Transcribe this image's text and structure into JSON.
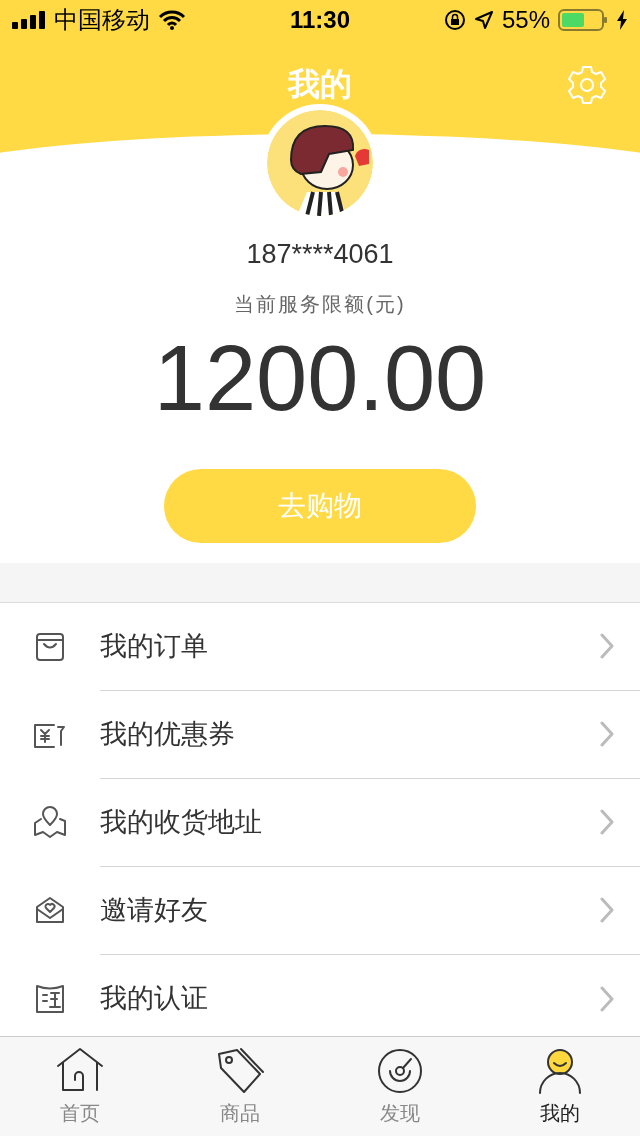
{
  "status_bar": {
    "carrier": "中国移动",
    "time": "11:30",
    "battery": "55%"
  },
  "header": {
    "title": "我的"
  },
  "profile": {
    "phone": "187****4061",
    "limit_label": "当前服务限额(元)",
    "limit_amount": "1200.00",
    "action_button": "去购物"
  },
  "menu": [
    {
      "kind": "orders",
      "label": "我的订单"
    },
    {
      "kind": "coupons",
      "label": "我的优惠券"
    },
    {
      "kind": "address",
      "label": "我的收货地址"
    },
    {
      "kind": "invite",
      "label": "邀请好友"
    },
    {
      "kind": "verify",
      "label": "我的认证"
    }
  ],
  "tab_bar": [
    {
      "kind": "home",
      "label": "首页",
      "selected": false
    },
    {
      "kind": "goods",
      "label": "商品",
      "selected": false
    },
    {
      "kind": "discover",
      "label": "发现",
      "selected": false
    },
    {
      "kind": "me",
      "label": "我的",
      "selected": true
    }
  ]
}
